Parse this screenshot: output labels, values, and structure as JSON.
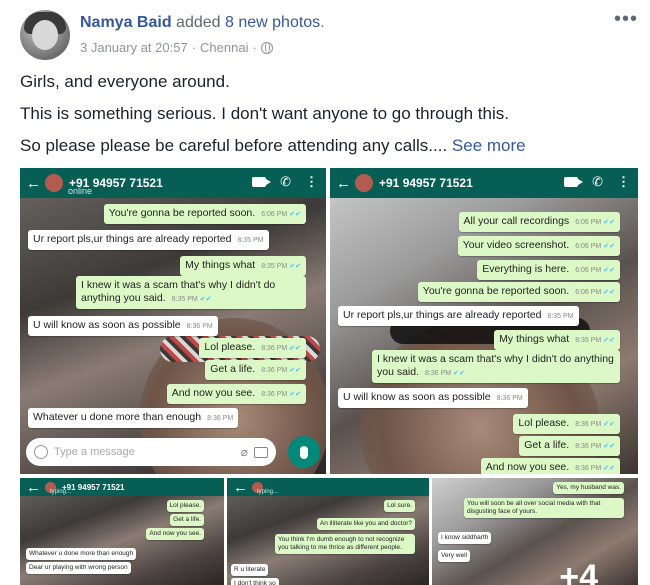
{
  "post": {
    "author": "Namya Baid",
    "action_prefix": "added",
    "action_count": "8 new photos",
    "action_suffix": ".",
    "date": "3 January at 20:57",
    "separator": "·",
    "location": "Chennai",
    "separator2": "·",
    "more_icon": "•••",
    "line1": "Girls, and everyone around.",
    "line2": "This is something serious. I don't want anyone to go through this.",
    "line3": "So please please be careful before attending any calls....",
    "see_more": "See more"
  },
  "icons": {
    "avatar": "profile-photo",
    "globe": "globe-icon",
    "more": "more-options-icon"
  },
  "photo1": {
    "contact": "+91 94957 71521",
    "status": "online",
    "messages": [
      {
        "text": "You're gonna be reported soon.",
        "time": "6:06 PM",
        "dir": "out"
      },
      {
        "text": "Ur report pls,ur things are already reported",
        "time": "8:35 PM",
        "dir": "in"
      },
      {
        "text": "My things what",
        "time": "8:35 PM",
        "dir": "out"
      },
      {
        "text": "I knew it was a scam that's why I didn't do anything you said.",
        "time": "8:35 PM",
        "dir": "out"
      },
      {
        "text": "U will know as soon as possible",
        "time": "8:36 PM",
        "dir": "in"
      },
      {
        "text": "Lol please.",
        "time": "8:36 PM",
        "dir": "out"
      },
      {
        "text": "Get a life.",
        "time": "8:36 PM",
        "dir": "out"
      },
      {
        "text": "And now you see.",
        "time": "8:36 PM",
        "dir": "out"
      },
      {
        "text": "Whatever u done more than enough",
        "time": "8:36 PM",
        "dir": "in"
      }
    ],
    "input_placeholder": "Type a message"
  },
  "photo2": {
    "contact": "+91 94957 71521",
    "messages": [
      {
        "text": "All your call recordings",
        "time": "6:06 PM",
        "dir": "out"
      },
      {
        "text": "Your video screenshot.",
        "time": "6:06 PM",
        "dir": "out"
      },
      {
        "text": "Everything is here.",
        "time": "6:06 PM",
        "dir": "out"
      },
      {
        "text": "You're gonna be reported soon.",
        "time": "6:06 PM",
        "dir": "out"
      },
      {
        "text": "Ur report pls,ur things are already reported",
        "time": "8:35 PM",
        "dir": "in"
      },
      {
        "text": "My things what",
        "time": "8:35 PM",
        "dir": "out"
      },
      {
        "text": "I knew it was a scam that's why I didn't do anything you said.",
        "time": "8:36 PM",
        "dir": "out"
      },
      {
        "text": "U will know as soon as possible",
        "time": "8:36 PM",
        "dir": "in"
      },
      {
        "text": "Lol please.",
        "time": "8:36 PM",
        "dir": "out"
      },
      {
        "text": "Get a life.",
        "time": "8:36 PM",
        "dir": "out"
      },
      {
        "text": "And now you see.",
        "time": "8:36 PM",
        "dir": "out"
      }
    ]
  },
  "photo3": {
    "contact": "+91 94957 71521",
    "status": "typing...",
    "messages": [
      {
        "text": "Lol please.",
        "dir": "out"
      },
      {
        "text": "Get a life.",
        "dir": "out"
      },
      {
        "text": "And now you see.",
        "dir": "out"
      },
      {
        "text": "Whatever u done more than enough",
        "dir": "in"
      },
      {
        "text": "Dear ur playing with wrong person",
        "dir": "in"
      }
    ]
  },
  "photo4": {
    "status": "typing...",
    "messages": [
      {
        "text": "Lol sure.",
        "dir": "out"
      },
      {
        "text": "An illiterate like you and doctor?",
        "dir": "out"
      },
      {
        "text": "You think I'm dumb enough to not recognize you talking to me thrice as different people.",
        "dir": "out"
      },
      {
        "text": "R u literate",
        "dir": "in"
      },
      {
        "text": "I don't think so",
        "dir": "in"
      }
    ]
  },
  "photo5": {
    "messages": [
      {
        "text": "Yes, my husband was.",
        "dir": "out"
      },
      {
        "text": "You will soon be all over social media with that disgusting face of yours.",
        "dir": "out"
      },
      {
        "text": "I know siddharth",
        "dir": "in"
      },
      {
        "text": "Very well",
        "dir": "in"
      }
    ],
    "more_count": "+4"
  }
}
